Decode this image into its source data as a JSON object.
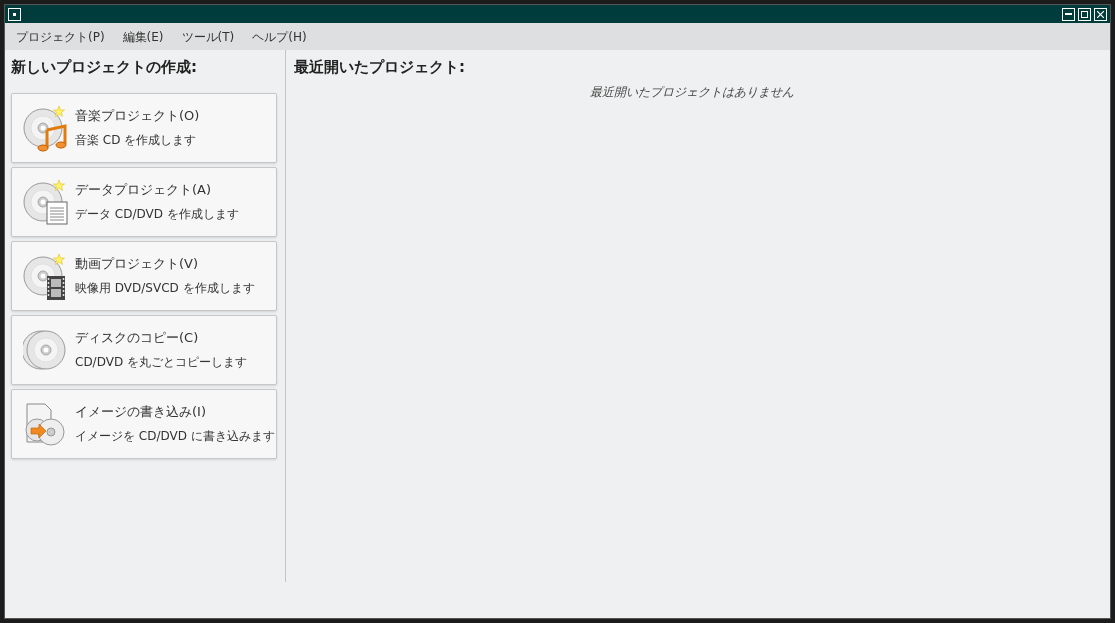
{
  "menu": [
    "プロジェクト(P)",
    "編集(E)",
    "ツール(T)",
    "ヘルプ(H)"
  ],
  "new_project": {
    "title": "新しいプロジェクトの作成:",
    "items": [
      {
        "kind": "audio",
        "title": "音楽プロジェクト(O)",
        "description": "音楽 CD を作成します"
      },
      {
        "kind": "data",
        "title": "データプロジェクト(A)",
        "description": "データ CD/DVD を作成します"
      },
      {
        "kind": "video",
        "title": "動画プロジェクト(V)",
        "description": "映像用 DVD/SVCD を作成します"
      },
      {
        "kind": "copy",
        "title": "ディスクのコピー(C)",
        "description": "CD/DVD を丸ごとコピーします"
      },
      {
        "kind": "image",
        "title": "イメージの書き込み(I)",
        "description": "イメージを CD/DVD に書き込みます"
      }
    ]
  },
  "recent": {
    "title": "最近開いたプロジェクト:",
    "empty": "最近開いたプロジェクトはありません"
  }
}
